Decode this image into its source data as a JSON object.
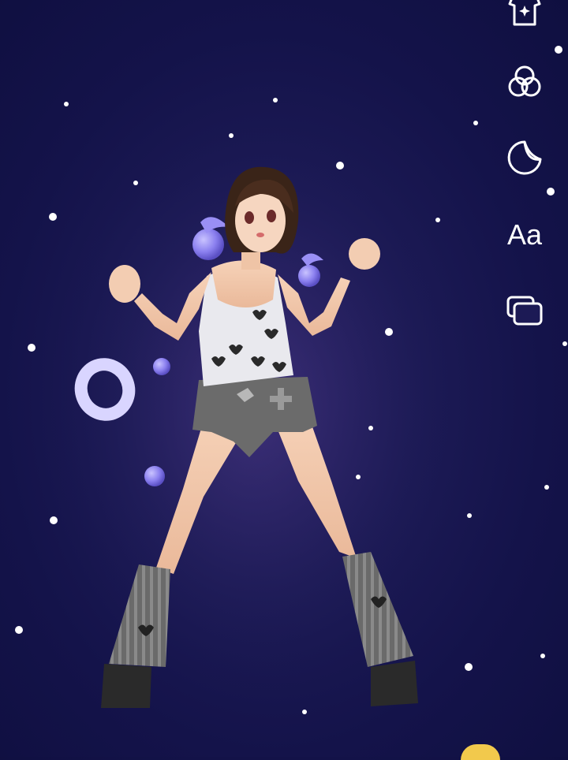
{
  "toolbar": {
    "items": [
      {
        "name": "outfit",
        "icon": "shirt-sparkle-icon"
      },
      {
        "name": "effects",
        "icon": "three-circles-icon"
      },
      {
        "name": "sticker",
        "icon": "moon-sticker-icon"
      },
      {
        "name": "text",
        "label": "Aa"
      },
      {
        "name": "layers",
        "icon": "stacked-windows-icon"
      }
    ]
  },
  "colors": {
    "background": "#1c1a55",
    "icon": "#ffffff",
    "orb": "#8f86f0",
    "corner_accent": "#f2c94c"
  }
}
